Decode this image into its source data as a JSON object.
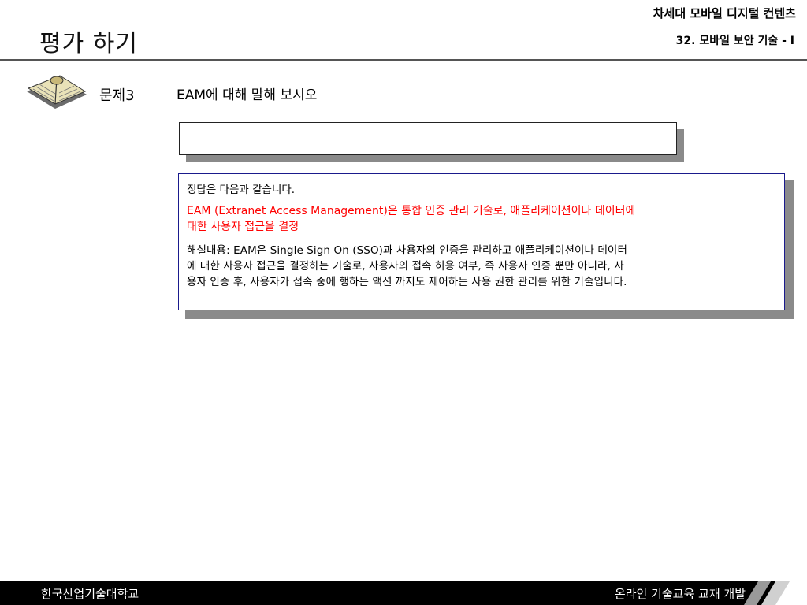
{
  "header": {
    "title": "평가 하기",
    "series": "차세대 모바일 디지털 컨텐츠",
    "lesson": "32. 모바일 보안 기술 - I"
  },
  "question": {
    "label": "문제3",
    "text": "EAM에 대해 말해 보시오",
    "answer_value": ""
  },
  "explanation": {
    "intro": "정답은 다음과 같습니다.",
    "answer_line1": "EAM (Extranet Access Management)은  통합 인증 관리 기술로, 애플리케이션이나 데이터에",
    "answer_line2": "대한 사용자 접근을 결정",
    "detail_line1": "해설내용: EAM은  Single Sign On (SSO)과 사용자의 인증을 관리하고 애플리케이션이나 데이터",
    "detail_line2": "에 대한 사용자 접근을 결정하는 기술로, 사용자의 접속 허용 여부, 즉 사용자 인증 뿐만 아니라, 사",
    "detail_line3": "용자 인증 후, 사용자가 접속 중에 행하는 액션 까지도 제어하는 사용 권한 관리를 위한 기술입니다."
  },
  "footer": {
    "left": "한국산업기술대학교",
    "right": "온라인 기술교육 교재 개발"
  },
  "colors": {
    "answer_red": "#ff0000",
    "box_border": "#1a1a8c",
    "footer_bg": "#000000"
  },
  "icons": {
    "question_icon": "open-book-icon"
  }
}
